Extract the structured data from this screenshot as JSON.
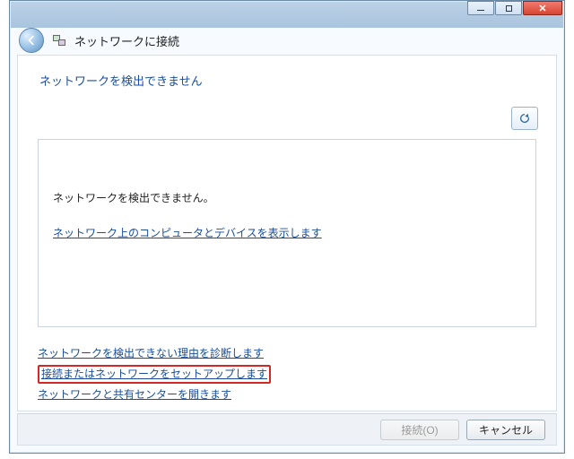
{
  "window": {
    "title": "ネットワークに接続"
  },
  "content": {
    "heading": "ネットワークを検出できません",
    "panel_message": "ネットワークを検出できません。",
    "panel_link": "ネットワーク上のコンピュータとデバイスを表示します"
  },
  "links": {
    "diagnose": "ネットワークを検出できない理由を診断します",
    "setup": "接続またはネットワークをセットアップします",
    "sharing_center": "ネットワークと共有センターを開きます"
  },
  "buttons": {
    "connect": "接続(O)",
    "cancel": "キャンセル"
  }
}
